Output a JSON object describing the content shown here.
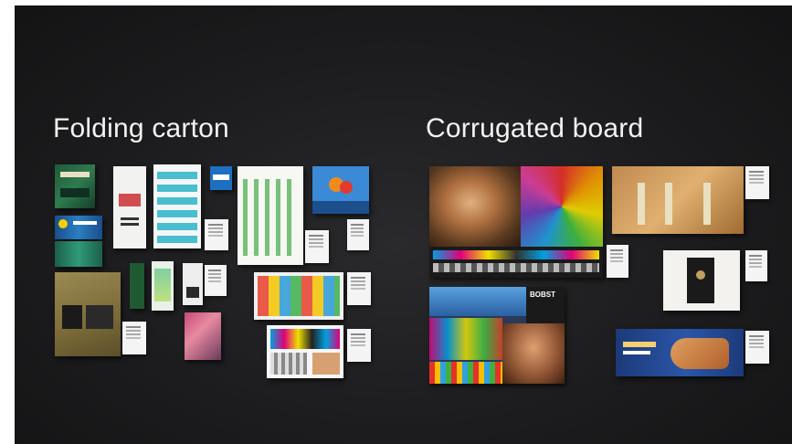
{
  "headings": {
    "folding_carton": "Folding carton",
    "corrugated_board": "Corrugated board"
  },
  "sample_text": {
    "brand_mark": "BOBST"
  },
  "colors": {
    "wall": "#1c1c1e",
    "heading_text": "#f2f2f2"
  }
}
